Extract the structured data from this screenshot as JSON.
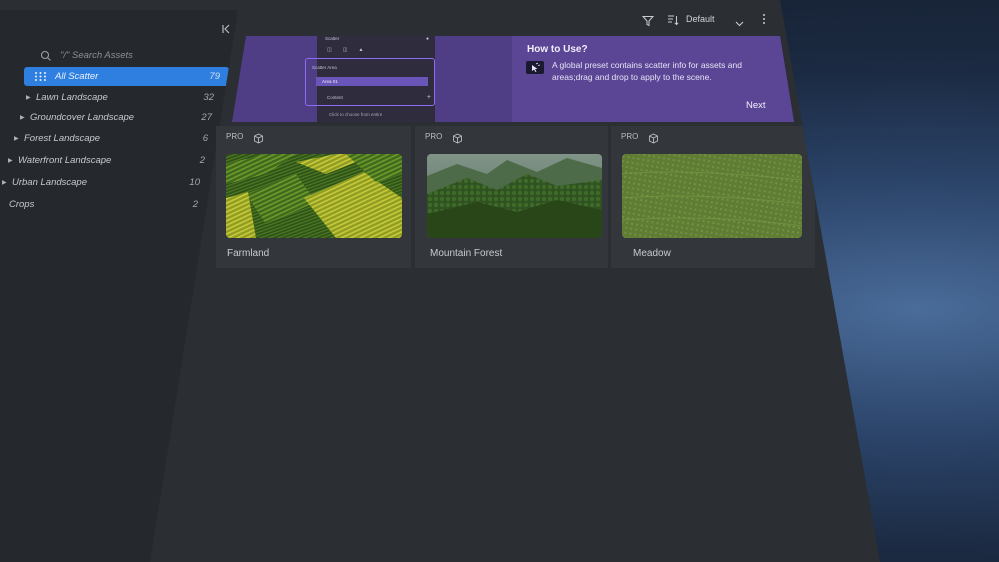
{
  "sidebar": {
    "search": {
      "placeholder": "\"/\" Search Assets"
    },
    "all_scatter": {
      "label": "All Scatter",
      "count": "79"
    },
    "categories": [
      {
        "label": "Lawn Landscape",
        "count": "32",
        "expandable": true
      },
      {
        "label": "Groundcover Landscape",
        "count": "27",
        "expandable": true
      },
      {
        "label": "Forest Landscape",
        "count": "6",
        "expandable": true
      },
      {
        "label": "Waterfront Landscape",
        "count": "2",
        "expandable": true
      },
      {
        "label": "Urban Landscape",
        "count": "10",
        "expandable": true
      },
      {
        "label": "Crops",
        "count": "2",
        "expandable": false
      }
    ]
  },
  "toolbar": {
    "sort_label": "Default",
    "icons": [
      "filter-icon",
      "sort-icon",
      "chevron-down-icon",
      "more-vertical-icon"
    ]
  },
  "banner": {
    "title": "How to Use?",
    "text": "A global preset contains scatter info for assets and areas;drag and drop to apply to the scene.",
    "next_label": "Next",
    "preview": {
      "title": "Scatter",
      "area_title": "Scatter Area",
      "area_item": "Area 01",
      "content_label": "Content",
      "footer": "Click to choose from entire"
    }
  },
  "cards": [
    {
      "badge": "PRO",
      "name": "Farmland"
    },
    {
      "badge": "PRO",
      "name": "Mountain Forest"
    },
    {
      "badge": "PRO",
      "name": "Meadow"
    }
  ],
  "colors": {
    "accent": "#2f7fe0",
    "banner": "#4f3d86",
    "panel": "#2b2e33",
    "sidebar": "#25282c"
  }
}
